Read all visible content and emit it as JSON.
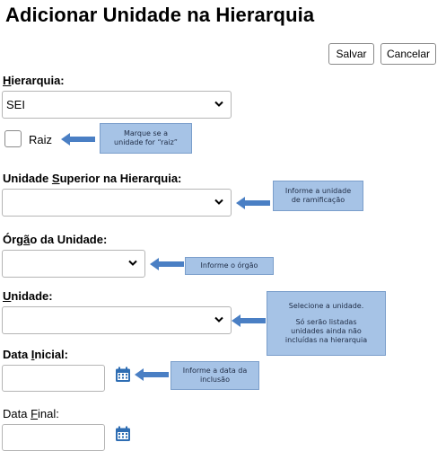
{
  "page": {
    "title": "Adicionar Unidade na Hierarquia"
  },
  "toolbar": {
    "save_label": "Salvar",
    "cancel_label": "Cancelar"
  },
  "hierarquia": {
    "label_prefix": "",
    "label_under": "H",
    "label_rest": "ierarquia:",
    "value": "SEI"
  },
  "raiz": {
    "label": "Raiz",
    "note": "Marque se a unidade for “raiz”"
  },
  "unidade_superior": {
    "label_prefix": "Unidade ",
    "label_under": "S",
    "label_rest": "uperior na Hierarquia:",
    "value": "",
    "note_line1": "Informe a unidade",
    "note_line2": "de ramificação"
  },
  "orgao": {
    "label_prefix": "Órg",
    "label_under": "ã",
    "label_rest": "o da Unidade:",
    "value": "",
    "note": "Informe o órgão"
  },
  "unidade": {
    "label_prefix": "",
    "label_under": "U",
    "label_rest": "nidade:",
    "value": "",
    "note_line1": "Selecione a unidade.",
    "note_line2": "Só serão listadas",
    "note_line3": "unidades ainda não",
    "note_line4": "incluídas na hierarquia"
  },
  "data_inicial": {
    "label_prefix": "Data ",
    "label_under": "I",
    "label_rest": "nicial:",
    "value": "",
    "note_line1": "Informe a data da",
    "note_line2": "inclusão"
  },
  "data_final": {
    "label_prefix": "Data ",
    "label_under": "F",
    "label_rest": "inal:",
    "value": ""
  },
  "colors": {
    "note_bg": "#a6c3e6",
    "arrow": "#4a7fc4"
  }
}
